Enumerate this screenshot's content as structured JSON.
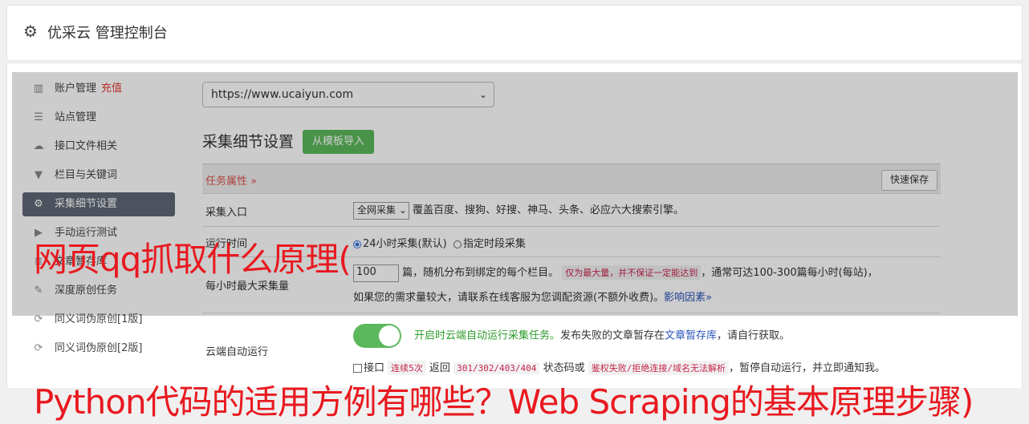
{
  "header": {
    "icon": "gear-icon",
    "title": "优采云 管理控制台"
  },
  "sidebar": {
    "items": [
      {
        "label": "账户管理",
        "badge": "充值",
        "icon": "bar-chart-icon"
      },
      {
        "label": "站点管理",
        "icon": "server-icon"
      },
      {
        "label": "接口文件相关",
        "icon": "cloud-upload-icon"
      },
      {
        "label": "栏目与关键词",
        "icon": "filter-icon"
      },
      {
        "label": "采集细节设置",
        "icon": "gears-icon",
        "active": true
      },
      {
        "label": "手动运行测试",
        "icon": "play-icon"
      },
      {
        "label": "文章暂存库",
        "icon": "database-icon"
      },
      {
        "label": "深度原创任务",
        "icon": "edit-icon"
      },
      {
        "label": "同义词伪原创[1版]",
        "icon": "refresh-icon"
      },
      {
        "label": "同义词伪原创[2版]",
        "icon": "refresh-icon"
      }
    ]
  },
  "main": {
    "site_select": "https://www.ucaiyun.com",
    "section_title": "采集细节设置",
    "template_button": "从模板导入",
    "props_label": "任务属性 »",
    "quick_save": "快速保存",
    "rows": {
      "entry": {
        "label": "采集入口",
        "select": "全网采集",
        "desc": "覆盖百度、搜狗、好搜、神马、头条、必应六大搜索引擎。"
      },
      "runtime": {
        "label": "运行时间",
        "opt1": "24小时采集(默认)",
        "opt2": "指定时段采集"
      },
      "max": {
        "label": "每小时最大采集量",
        "value": "100",
        "text1": "篇，随机分布到绑定的每个栏目。",
        "note": "仅为最大量，并不保证一定能达到",
        "text2": "，通常可达100-300篇每小时(每站)，",
        "text3": "如果您的需求量较大，请联系在线客服为您调配资源(不额外收费)。",
        "link": "影响因素»"
      },
      "cloud": {
        "label": "云端自动运行",
        "desc_green": "开启时云端自动运行采集任务。",
        "desc1": "发布失败的文章暂存在",
        "link": "文章暂存库",
        "desc2": "，请自行获取。",
        "cb_label": "接口",
        "code1": "连续5次",
        "t1": "返回",
        "code2": "301/302/403/404",
        "t2": "状态码或",
        "code3": "鉴权失败/拒绝连接/域名无法解析",
        "t3": "，暂停自动运行，并立即通知我。"
      }
    }
  },
  "watermark": {
    "line1": "网页qq抓取什么原理(",
    "line2": "Python代码的适用方例有哪些？Web Scraping的基本原理步骤)"
  }
}
